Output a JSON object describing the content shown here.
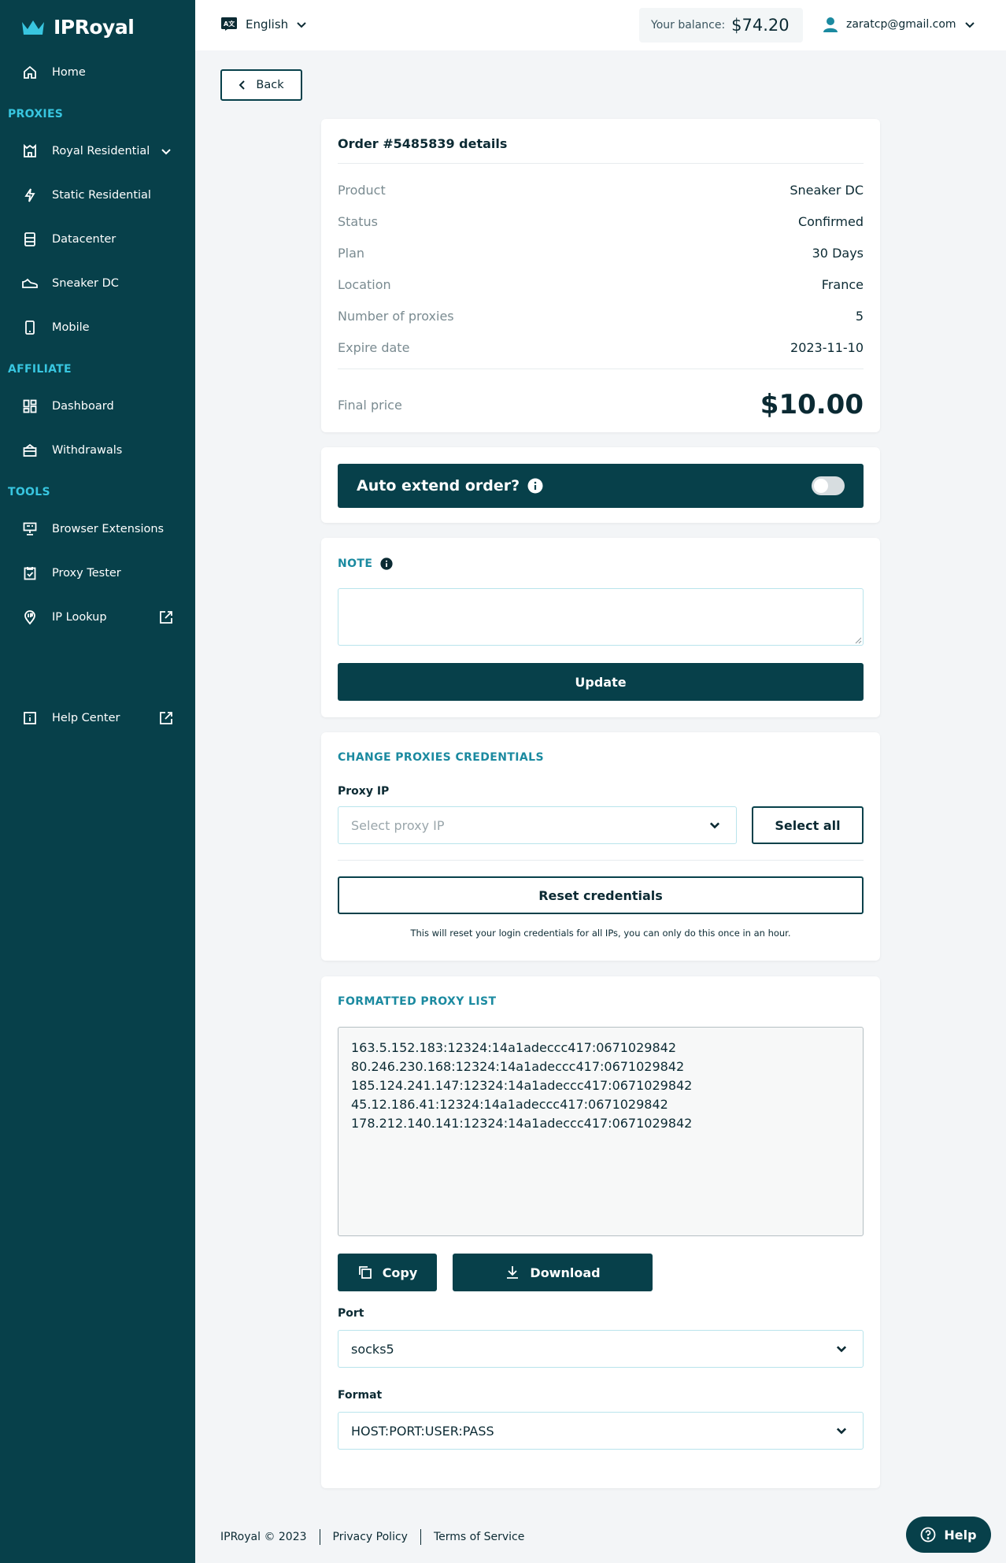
{
  "brand": {
    "name": "IPRoyal",
    "color_primary": "#07404a",
    "color_accent": "#38c6e0"
  },
  "sidebar": {
    "home": {
      "label": "Home",
      "icon": "home-icon"
    },
    "sections": {
      "proxies": "PROXIES",
      "affiliate": "AFFILIATE",
      "tools": "TOOLS"
    },
    "proxies": [
      {
        "label": "Royal Residential",
        "icon": "castle-icon"
      },
      {
        "label": "Static Residential",
        "icon": "bolt-icon"
      },
      {
        "label": "Datacenter",
        "icon": "server-icon"
      },
      {
        "label": "Sneaker DC",
        "icon": "sneaker-icon"
      },
      {
        "label": "Mobile",
        "icon": "phone-icon"
      }
    ],
    "affiliate": [
      {
        "label": "Dashboard",
        "icon": "grid-icon"
      },
      {
        "label": "Withdrawals",
        "icon": "wallet-icon"
      }
    ],
    "tools": [
      {
        "label": "Browser Extensions",
        "icon": "extension-icon"
      },
      {
        "label": "Proxy Tester",
        "icon": "clipboard-check-icon"
      },
      {
        "label": "IP Lookup",
        "icon": "ip-pin-icon"
      }
    ],
    "help_center": {
      "label": "Help Center",
      "icon": "info-square-icon"
    }
  },
  "header": {
    "language": "English",
    "balance_label": "Your balance:",
    "balance_value": "$74.20",
    "user_email": "zaratcp@gmail.com"
  },
  "back_label": "Back",
  "order": {
    "title": "Order #5485839 details",
    "rows": [
      {
        "key": "Product",
        "value": "Sneaker DC"
      },
      {
        "key": "Status",
        "value": "Confirmed"
      },
      {
        "key": "Plan",
        "value": "30 Days"
      },
      {
        "key": "Location",
        "value": "France"
      },
      {
        "key": "Number of proxies",
        "value": "5"
      },
      {
        "key": "Expire date",
        "value": "2023-11-10"
      }
    ],
    "final_label": "Final price",
    "final_value": "$10.00"
  },
  "auto_extend": {
    "label": "Auto extend order?",
    "enabled": false
  },
  "note": {
    "title": "NOTE",
    "value": "",
    "button": "Update"
  },
  "credentials": {
    "title": "CHANGE PROXIES CREDENTIALS",
    "proxy_ip_label": "Proxy IP",
    "proxy_ip_placeholder": "Select proxy IP",
    "select_all": "Select all",
    "reset": "Reset credentials",
    "reset_note": "This will reset your login credentials for all IPs, you can only do this once in an hour."
  },
  "proxy_list": {
    "title": "FORMATTED PROXY LIST",
    "lines": [
      "163.5.152.183:12324:14a1adeccc417:0671029842",
      "80.246.230.168:12324:14a1adeccc417:0671029842",
      "185.124.241.147:12324:14a1adeccc417:0671029842",
      "45.12.186.41:12324:14a1adeccc417:0671029842",
      "178.212.140.141:12324:14a1adeccc417:0671029842"
    ],
    "copy": "Copy",
    "download": "Download",
    "port_label": "Port",
    "port_value": "socks5",
    "format_label": "Format",
    "format_value": "HOST:PORT:USER:PASS"
  },
  "footer": {
    "copyright": "IPRoyal © 2023",
    "privacy": "Privacy Policy",
    "terms": "Terms of Service"
  },
  "help_button": "Help"
}
